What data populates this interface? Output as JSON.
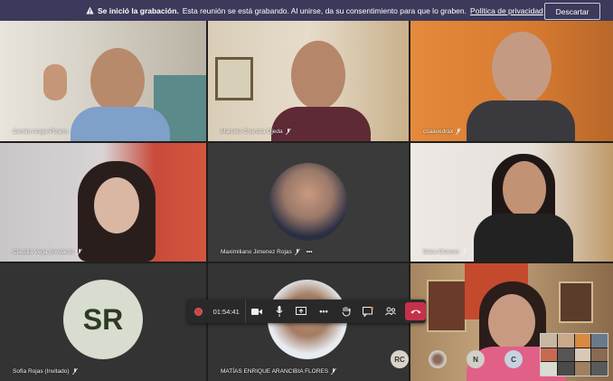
{
  "banner": {
    "title": "Se inició la grabación.",
    "message": "Esta reunión se está grabando. Al unirse, da su consentimiento para que lo graben.",
    "link": "Política de privacidad",
    "dismiss": "Descartar"
  },
  "participants": [
    {
      "name": "Camilo Araya Pizarro"
    },
    {
      "name": "Marcelo Chandía Ojeda"
    },
    {
      "name": "csaavedrax"
    },
    {
      "name": "Claudia Vega (Invitado)"
    },
    {
      "name": "Maximiliano Jimenez Rojas"
    },
    {
      "name": "Dana Donoso"
    },
    {
      "name": "Sofía Rojas (Invitado)",
      "initials": "SR"
    },
    {
      "name": "MATÍAS ENRIQUE ARANCIBIA FLORES"
    }
  ],
  "controls": {
    "timer": "01:54:41"
  },
  "roster": [
    {
      "initials": "RC",
      "color": "#d9d3c7"
    },
    {
      "initials": "N",
      "color": "#d0cfc9"
    },
    {
      "initials": "C",
      "color": "#c6d3de"
    }
  ],
  "colors": {
    "banner": "#3b3a5a",
    "hangup": "#c4314b",
    "sr_avatar": "#d9ddd0"
  }
}
